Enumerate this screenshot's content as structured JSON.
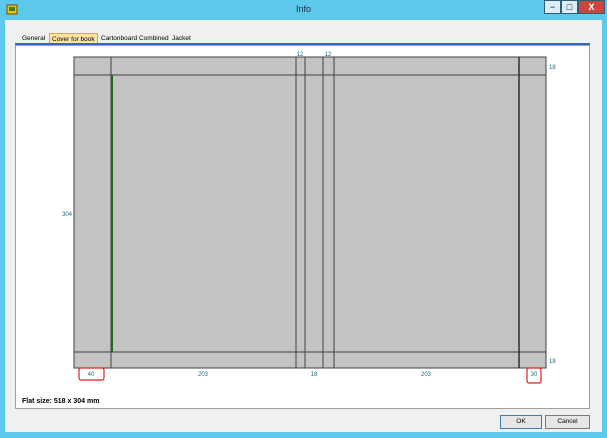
{
  "window": {
    "title": "Info",
    "min_label": "−",
    "max_label": "□",
    "close_label": "X"
  },
  "tabs": [
    {
      "label": "General"
    },
    {
      "label": "Cover for book"
    },
    {
      "label": "Cartonboard Combined"
    },
    {
      "label": "Jacket"
    }
  ],
  "diagram": {
    "top_labels": [
      "12",
      "12"
    ],
    "right_labels": [
      "18",
      "18"
    ],
    "left_label": "304",
    "bottom_labels": [
      "40",
      "203",
      "18",
      "203",
      "30"
    ]
  },
  "status": {
    "flat_size": "Flat size: 518 x 304 mm"
  },
  "buttons": {
    "ok": "OK",
    "cancel": "Cancel"
  }
}
